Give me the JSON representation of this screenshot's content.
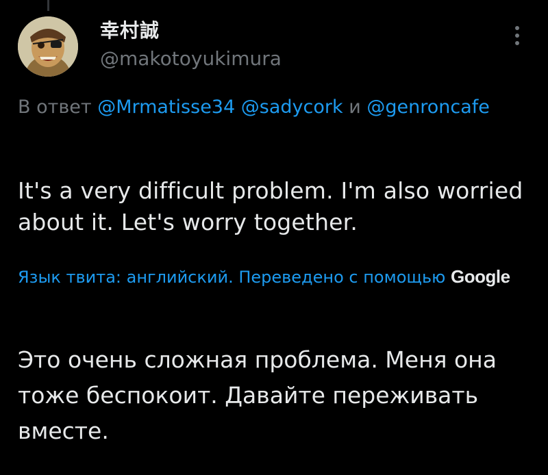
{
  "tweet": {
    "author": {
      "display_name": "幸村誠",
      "handle": "@makotoyukimura"
    },
    "reply_context": {
      "prefix": "В ответ",
      "mentions": [
        "@Mrmatisse34",
        "@sadycork",
        "@genroncafe"
      ],
      "conjunction": "и"
    },
    "text": "It's a very difficult problem. I'm also worried about it. Let's worry together.",
    "translation_note": {
      "text": "Язык твита: английский. Переведено с помощью",
      "provider": "Google"
    },
    "translated_text": "Это очень сложная проблема. Меня она тоже беспокоит. Давайте переживать вместе."
  },
  "icons": {
    "more": "more-vertical-icon",
    "avatar": "avatar-image"
  },
  "colors": {
    "background": "#000000",
    "primary_text": "#e7e9ea",
    "secondary_text": "#71767b",
    "link": "#1d9bf0"
  }
}
